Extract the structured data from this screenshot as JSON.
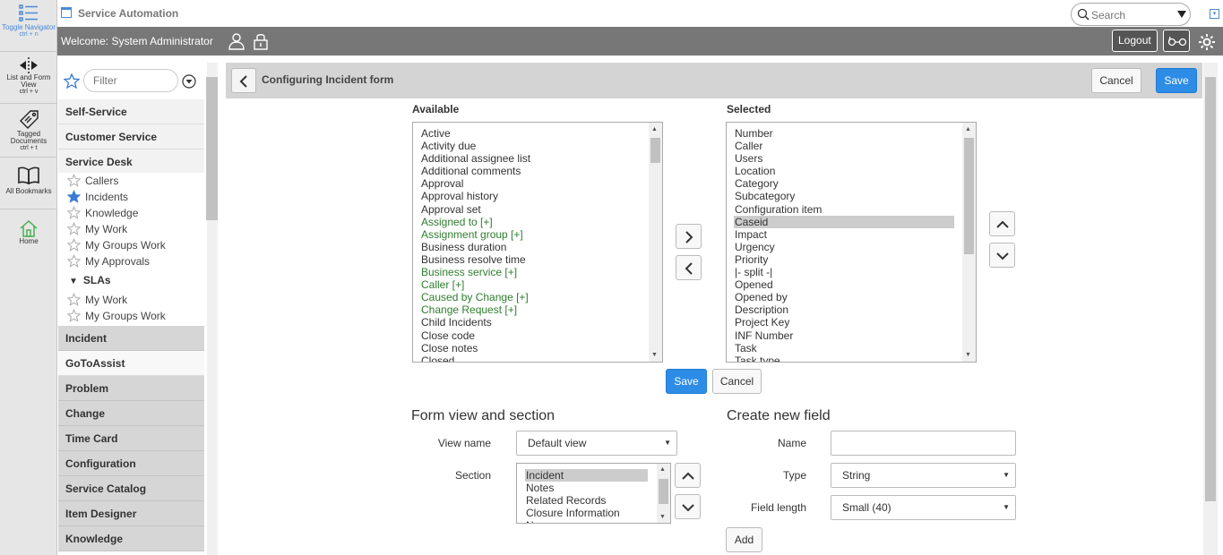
{
  "leftbar": {
    "toggle": {
      "label": "Toggle Navigator",
      "shortcut": "ctrl + n",
      "icon": "list-icon"
    },
    "listform": {
      "label": "List and Form View",
      "shortcut": "ctrl + v",
      "icon": "split-arrows-icon"
    },
    "tagged": {
      "label": "Tagged Documents",
      "shortcut": "ctrl + t",
      "icon": "tag-icon"
    },
    "bookmarks": {
      "label": "All Bookmarks",
      "icon": "book-icon"
    },
    "home": {
      "label": "Home",
      "icon": "home-icon"
    }
  },
  "header": {
    "title": "Service Automation",
    "search_placeholder": "Search",
    "welcome": "Welcome:  System Administrator",
    "logout": "Logout"
  },
  "navigator": {
    "filter_placeholder": "Filter",
    "sections": {
      "self_service": "Self-Service",
      "customer_service": "Customer Service",
      "service_desk": "Service Desk",
      "incident": "Incident",
      "gotoassist": "GoToAssist",
      "problem": "Problem",
      "change": "Change",
      "time_card": "Time Card",
      "configuration": "Configuration",
      "service_catalog": "Service Catalog",
      "item_designer": "Item Designer",
      "knowledge": "Knowledge"
    },
    "service_desk_items": [
      "Callers",
      "Incidents",
      "Knowledge",
      "My Work",
      "My Groups Work",
      "My Approvals"
    ],
    "slas_label": "SLAs",
    "sla_items": [
      "My Work",
      "My Groups Work"
    ]
  },
  "form": {
    "title": "Configuring Incident form",
    "cancel": "Cancel",
    "save": "Save",
    "available_label": "Available",
    "selected_label": "Selected",
    "available": [
      "Active",
      "Activity due",
      "Additional assignee list",
      "Additional comments",
      "Approval",
      "Approval history",
      "Approval set",
      "Assigned to [+]",
      "Assignment group [+]",
      "Business duration",
      "Business resolve time",
      "Business service [+]",
      "Caller [+]",
      "Caused by Change [+]",
      "Change Request [+]",
      "Child Incidents",
      "Close code",
      "Close notes",
      "Closed"
    ],
    "available_refs": [
      7,
      8,
      11,
      12,
      13,
      14
    ],
    "selected": [
      "Number",
      "Caller",
      "Users",
      "Location",
      "Category",
      "Subcategory",
      "Configuration item",
      "Caseid",
      "Impact",
      "Urgency",
      "Priority",
      "|- split -|",
      "Opened",
      "Opened by",
      "Description",
      "Project Key",
      "INF Number",
      "Task",
      "Task type"
    ],
    "selected_highlight": 7,
    "mid_save": "Save",
    "mid_cancel": "Cancel"
  },
  "form_view": {
    "title": "Form view and section",
    "view_name_label": "View name",
    "view_name_value": "Default view",
    "section_label": "Section",
    "sections": [
      "Incident",
      "Notes",
      "Related Records",
      "Closure Information",
      "New"
    ]
  },
  "new_field": {
    "title": "Create new field",
    "name_label": "Name",
    "name_value": "",
    "type_label": "Type",
    "type_value": "String",
    "length_label": "Field length",
    "length_value": "Small (40)",
    "add": "Add"
  }
}
